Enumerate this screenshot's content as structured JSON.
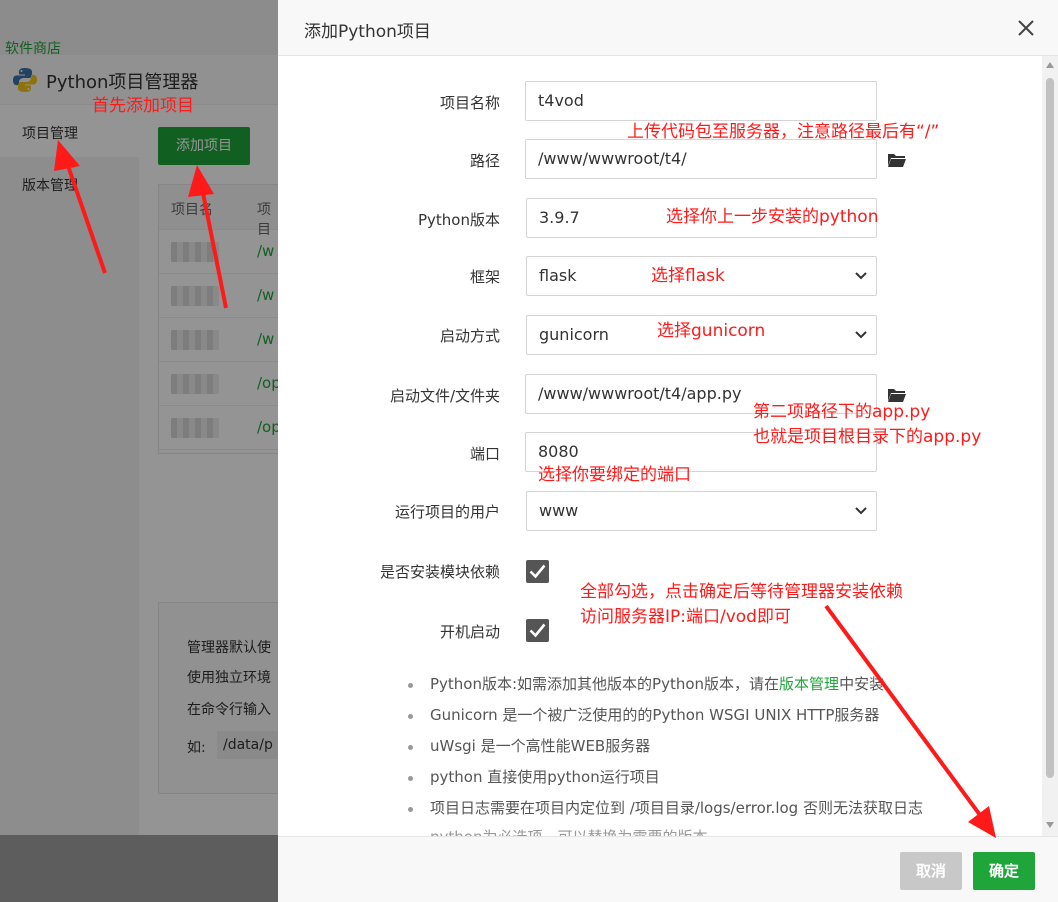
{
  "background": {
    "store_label": "软件商店",
    "app_title": "Python项目管理器",
    "sidebar": [
      {
        "label": "项目管理"
      },
      {
        "label": "版本管理"
      }
    ],
    "add_button": "添加项目",
    "table_headers": [
      "项目名",
      "项目"
    ],
    "row_paths": [
      "/w",
      "/w",
      "/w",
      "/op",
      "/op"
    ],
    "notes": [
      "管理器默认使",
      "使用独立环境",
      "在命令行输入",
      "如: ",
      "/data/p"
    ]
  },
  "modal": {
    "title": "添加Python项目",
    "close_icon": "close-icon",
    "fields": {
      "project_name": {
        "label": "项目名称",
        "value": "t4vod"
      },
      "path": {
        "label": "路径",
        "value": "/www/wwwroot/t4/"
      },
      "python_version": {
        "label": "Python版本",
        "value": "3.9.7"
      },
      "framework": {
        "label": "框架",
        "value": "flask"
      },
      "start_method": {
        "label": "启动方式",
        "value": "gunicorn"
      },
      "start_file": {
        "label": "启动文件/文件夹",
        "value": "/www/wwwroot/t4/app.py"
      },
      "port": {
        "label": "端口",
        "value": "8080"
      },
      "run_user": {
        "label": "运行项目的用户",
        "value": "www"
      },
      "install_deps": {
        "label": "是否安装模块依赖",
        "checked": true
      },
      "autostart": {
        "label": "开机启动",
        "checked": true
      }
    },
    "tips": {
      "t1_pre": "Python版本:如需添加其他版本的Python版本，请在",
      "t1_link": "版本管理",
      "t1_post": "中安装",
      "t2": "Gunicorn 是一个被广泛使用的的Python WSGI UNIX HTTP服务器",
      "t3": "uWsgi 是一个高性能WEB服务器",
      "t4": "python 直接使用python运行项目",
      "t5": "项目日志需要在项目内定位到 /项目目录/logs/error.log 否则无法获取日志",
      "t6": "python为必选项，可以替换为需要的版本"
    },
    "buttons": {
      "cancel": "取消",
      "ok": "确定"
    }
  },
  "annotations": {
    "add_first": "首先添加项目",
    "upload_code": "上传代码包至服务器，注意路径最后有“/”",
    "select_python": "选择你上一步安装的python",
    "select_flask": "选择flask",
    "select_gunicorn": "选择gunicorn",
    "app_py_line1": "第二项路径下的app.py",
    "app_py_line2": "也就是项目根目录下的app.py",
    "select_port": "选择你要绑定的端口",
    "check_all_line1": "全部勾选，点击确定后等待管理器安装依赖",
    "check_all_line2": "访问服务器IP:端口/vod即可",
    "color": "#ff1a1a"
  }
}
